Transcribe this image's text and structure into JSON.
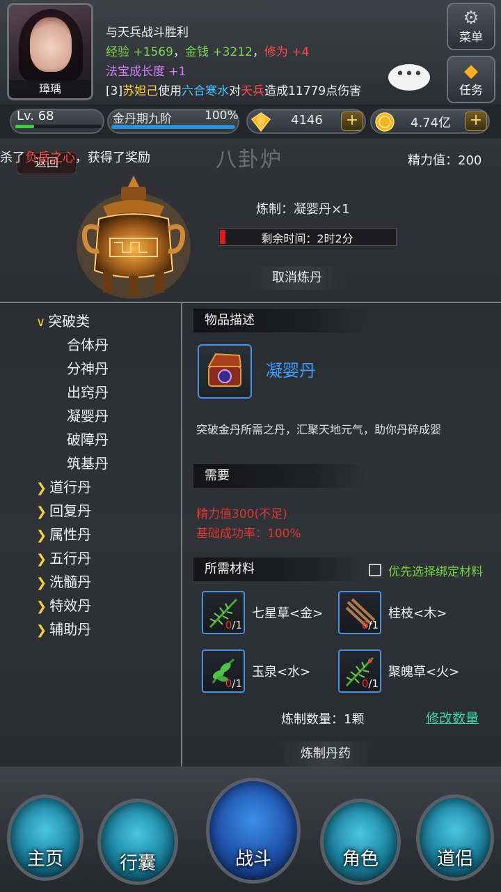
{
  "header": {
    "avatar_name": "璋瑀",
    "log": {
      "line1": "与天兵战斗胜利",
      "line2": {
        "exp_label": "经验",
        "exp_value": "+1569",
        "sep1": "，",
        "money_label": "金钱",
        "money_value": "+3212",
        "sep2": "，",
        "cultivation_label": "修为",
        "cultivation_value": "+4"
      },
      "line3": {
        "label": "法宝成长度",
        "value": "+1"
      },
      "line4": {
        "prefix": "[3]",
        "actor": "苏妲己",
        "verb1": "使用",
        "skill": "六合寒水",
        "verb2": "对",
        "target": "天兵",
        "suffix": "造成11779点伤害"
      }
    },
    "menu_label": "菜单",
    "task_label": "任务",
    "chat_bubble": "•••"
  },
  "stats": {
    "level_label": "Lv. 68",
    "level_progress": 0.22,
    "realm_label": "金丹期九阶",
    "realm_pct": "100%",
    "realm_progress": 1.0,
    "gem_value": "4146",
    "coin_value": "4.74亿",
    "plus": "+"
  },
  "furnace": {
    "notice_prefix": "杀了",
    "notice_target": "负岳之心",
    "notice_suffix": "，获得了奖励",
    "back_label": "返回",
    "title": "八卦炉",
    "energy_label": "精力值：200",
    "craft_label": "炼制：凝婴丹×1",
    "timer_label": "剩余时间：2时2分",
    "timer_progress": 0.03,
    "cancel_label": "取消炼丹"
  },
  "categories": {
    "expanded": {
      "label": "突破类",
      "items": [
        "合体丹",
        "分神丹",
        "出窍丹",
        "凝婴丹",
        "破障丹",
        "筑基丹"
      ]
    },
    "collapsed": [
      "道行丹",
      "回复丹",
      "属性丹",
      "五行丹",
      "洗髓丹",
      "特效丹",
      "辅助丹"
    ]
  },
  "detail": {
    "desc_header": "物品描述",
    "item_name": "凝婴丹",
    "item_desc": "突破金丹所需之丹，汇聚天地元气，助你丹碎成婴",
    "req_header": "需要",
    "req_energy": "精力值300(不足)",
    "req_rate": "基础成功率：100%",
    "mat_header": "所需材料",
    "bind_label": "优先选择绑定材料",
    "materials": [
      {
        "name": "七星草<金>",
        "have": "0",
        "need": "/1"
      },
      {
        "name": "桂枝<木>",
        "have": "0",
        "need": "/1"
      },
      {
        "name": "玉泉<水>",
        "have": "0",
        "need": "/1"
      },
      {
        "name": "聚魄草<火>",
        "have": "0",
        "need": "/1"
      }
    ],
    "qty_label": "炼制数量：1颗",
    "modify_label": "修改数量",
    "craft_label": "炼制丹药"
  },
  "nav": [
    {
      "label": "主页"
    },
    {
      "label": "行囊"
    },
    {
      "label": "战斗"
    },
    {
      "label": "角色"
    },
    {
      "label": "道侣"
    }
  ],
  "colors": {
    "accent_blue": "#3a9cff",
    "warning_red": "#e03434",
    "success_green": "#6ed23a",
    "link_teal": "#3ed8a8"
  }
}
